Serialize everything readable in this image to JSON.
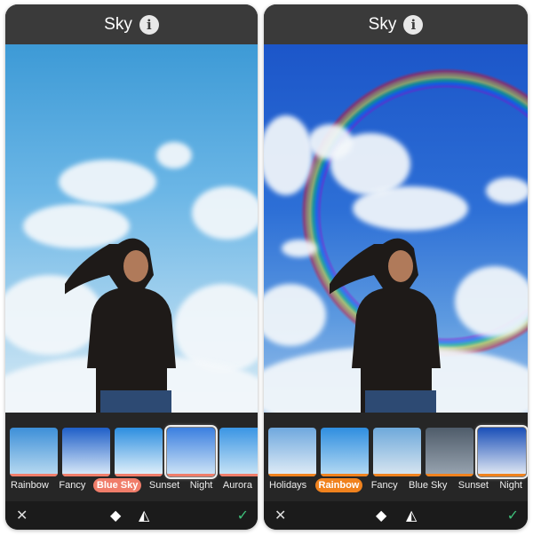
{
  "panels": [
    {
      "title": "Sky",
      "sky_items": [
        "Rainbow",
        "Fancy",
        "Blue Sky",
        "Sunset",
        "Night",
        "Aurora"
      ],
      "active_label": "Blue Sky",
      "selected_thumb": "Sunset",
      "accent": "#f07d6a"
    },
    {
      "title": "Sky",
      "sky_items": [
        "Holidays",
        "Rainbow",
        "Fancy",
        "Blue Sky",
        "Sunset",
        "Night"
      ],
      "active_label": "Rainbow",
      "selected_thumb": "Night",
      "accent": "#f0821e"
    }
  ],
  "icons": {
    "info": "i",
    "close": "✕",
    "eraser": "eraser-icon",
    "mirror": "mirror-icon",
    "check": "✓"
  }
}
